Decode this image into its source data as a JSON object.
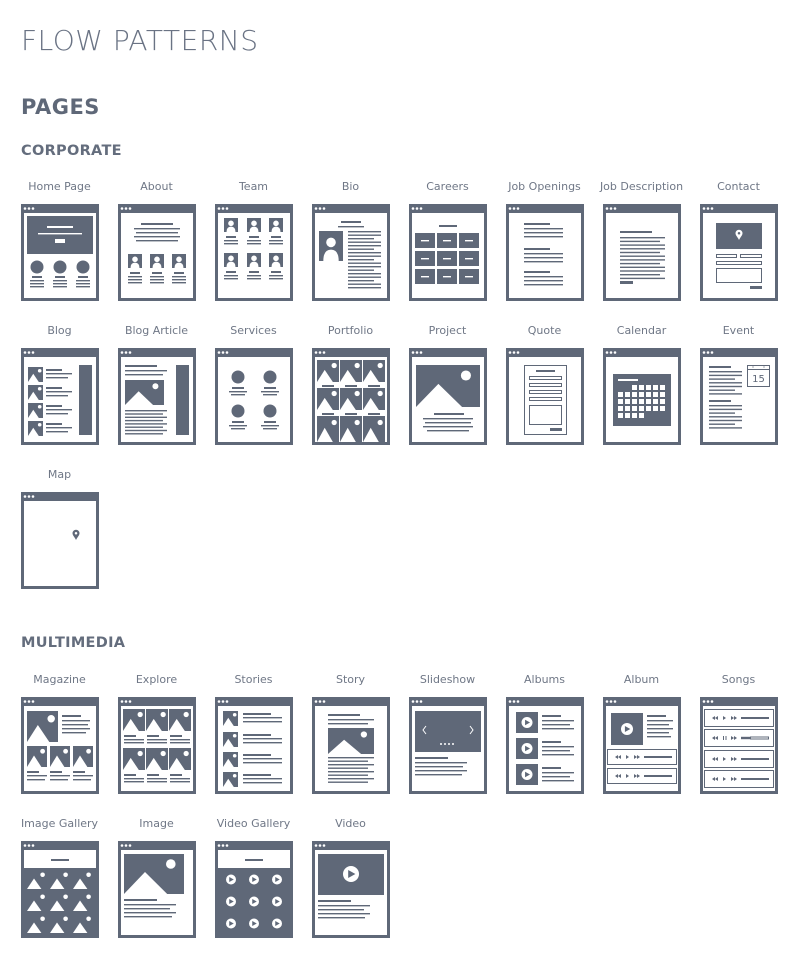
{
  "title": "FLOW PATTERNS",
  "section": "PAGES",
  "colors": {
    "ink": "#5f6878",
    "paper": "#ffffff",
    "light": "#c9ccd3"
  },
  "groups": [
    {
      "name": "CORPORATE",
      "items": [
        {
          "label": "Home Page",
          "icon": "home-page"
        },
        {
          "label": "About",
          "icon": "about"
        },
        {
          "label": "Team",
          "icon": "team"
        },
        {
          "label": "Bio",
          "icon": "bio"
        },
        {
          "label": "Careers",
          "icon": "careers"
        },
        {
          "label": "Job Openings",
          "icon": "job-openings"
        },
        {
          "label": "Job Description",
          "icon": "job-description"
        },
        {
          "label": "Contact",
          "icon": "contact"
        },
        {
          "label": "Blog",
          "icon": "blog"
        },
        {
          "label": "Blog Article",
          "icon": "blog-article"
        },
        {
          "label": "Services",
          "icon": "services"
        },
        {
          "label": "Portfolio",
          "icon": "portfolio"
        },
        {
          "label": "Project",
          "icon": "project"
        },
        {
          "label": "Quote",
          "icon": "quote"
        },
        {
          "label": "Calendar",
          "icon": "calendar"
        },
        {
          "label": "Event",
          "icon": "event",
          "date_number": "15"
        },
        {
          "label": "Map",
          "icon": "map"
        }
      ]
    },
    {
      "name": "MULTIMEDIA",
      "items": [
        {
          "label": "Magazine",
          "icon": "magazine"
        },
        {
          "label": "Explore",
          "icon": "explore"
        },
        {
          "label": "Stories",
          "icon": "stories"
        },
        {
          "label": "Story",
          "icon": "story"
        },
        {
          "label": "Slideshow",
          "icon": "slideshow"
        },
        {
          "label": "Albums",
          "icon": "albums"
        },
        {
          "label": "Album",
          "icon": "album"
        },
        {
          "label": "Songs",
          "icon": "songs"
        },
        {
          "label": "Image Gallery",
          "icon": "image-gallery"
        },
        {
          "label": "Image",
          "icon": "image"
        },
        {
          "label": "Video Gallery",
          "icon": "video-gallery"
        },
        {
          "label": "Video",
          "icon": "video"
        }
      ]
    }
  ]
}
